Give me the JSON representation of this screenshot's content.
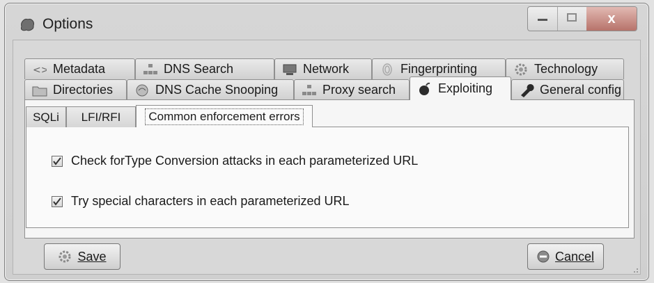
{
  "window": {
    "title": "Options",
    "close_glyph": "x"
  },
  "tabs_row1": [
    {
      "label": "Metadata",
      "icon": "metadata-icon"
    },
    {
      "label": "DNS Search",
      "icon": "dns-search-icon"
    },
    {
      "label": "Network",
      "icon": "network-icon"
    },
    {
      "label": "Fingerprinting",
      "icon": "fingerprint-icon"
    },
    {
      "label": "Technology",
      "icon": "gear-icon"
    }
  ],
  "tabs_row2": [
    {
      "label": "Directories",
      "icon": "folder-icon"
    },
    {
      "label": "DNS Cache Snooping",
      "icon": "dns-cache-icon"
    },
    {
      "label": "Proxy search",
      "icon": "proxy-icon"
    },
    {
      "label": "Exploiting",
      "icon": "bomb-icon",
      "active": true
    },
    {
      "label": "General config",
      "icon": "wrench-icon"
    }
  ],
  "subtabs": [
    {
      "label": "SQLi"
    },
    {
      "label": "LFI/RFI"
    },
    {
      "label": "Common enforcement errors",
      "active": true
    }
  ],
  "options": [
    {
      "label": "Check forType Conversion attacks in each parameterized URL",
      "checked": true
    },
    {
      "label": "Try special characters in each parameterized URL",
      "checked": true
    }
  ],
  "buttons": {
    "save_label": "Save",
    "cancel_label": "Cancel"
  },
  "colors": {
    "close_button": "#b7736a",
    "active_tab": "#f6f6f6",
    "window_chrome": "#d6d6d6"
  }
}
